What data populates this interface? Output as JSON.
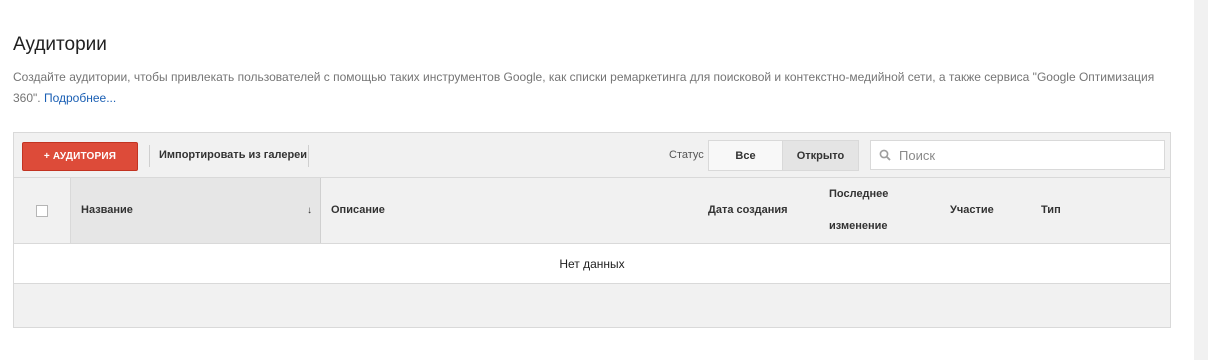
{
  "page": {
    "title": "Аудитории",
    "description": "Создайте аудитории, чтобы привлекать пользователей с помощью таких инструментов Google, как списки ремаркетинга для поисковой и контекстно-медийной сети, а также сервиса \"Google Оптимизация 360\".",
    "learn_more": "Подробнее..."
  },
  "toolbar": {
    "add_label": "+ АУДИТОРИЯ",
    "import_label": "Импортировать из галереи",
    "status_label": "Статус",
    "status_options": [
      "Все",
      "Открыто"
    ],
    "status_selected": "Открыто",
    "search_placeholder": "Поиск"
  },
  "table": {
    "headers": {
      "name": "Название",
      "description": "Описание",
      "created": "Дата создания",
      "modified_line1": "Последнее",
      "modified_line2": "изменение",
      "participation": "Участие",
      "type": "Тип"
    },
    "sort_indicator": "↓",
    "empty_text": "Нет данных"
  },
  "colors": {
    "accent_button": "#dd4b39",
    "link": "#1a5fb4"
  }
}
